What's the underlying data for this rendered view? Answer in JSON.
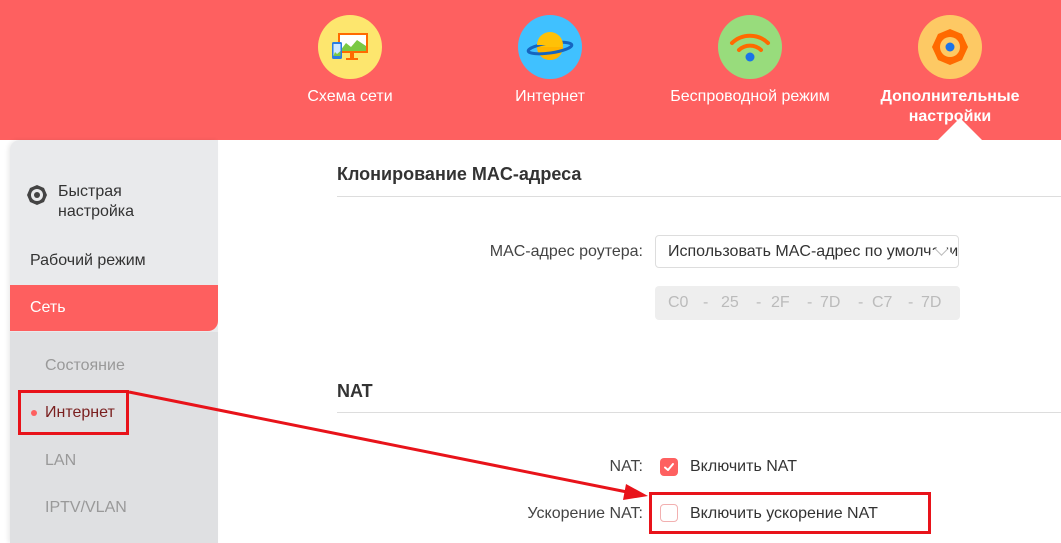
{
  "header": {
    "nav": [
      {
        "label": "Схема сети",
        "icon": "network-map-icon"
      },
      {
        "label": "Интернет",
        "icon": "planet-icon"
      },
      {
        "label": "Беспроводной режим",
        "icon": "wifi-icon"
      },
      {
        "label": "Дополнительные настройки",
        "icon": "gear-icon",
        "active": true
      }
    ]
  },
  "sidebar": {
    "items": [
      {
        "label": "Быстрая настройка",
        "icon": "gear-icon"
      },
      {
        "label": "Рабочий режим"
      },
      {
        "label": "Сеть",
        "active": true
      }
    ],
    "sub_items": [
      {
        "label": "Состояние"
      },
      {
        "label": "Интернет",
        "current": true
      },
      {
        "label": "LAN"
      },
      {
        "label": "IPTV/VLAN"
      }
    ]
  },
  "mac_clone": {
    "title": "Клонирование MAC-адреса",
    "router_mac_label": "MAC-адрес роутера:",
    "router_mac_select_value": "Использовать MAC-адрес по умолчанию",
    "mac_octets": [
      "C0",
      "25",
      "2F",
      "7D",
      "C7",
      "7D"
    ],
    "separator": "-"
  },
  "nat": {
    "title": "NAT",
    "nat_label": "NAT:",
    "nat_checkbox_label": "Включить NAT",
    "nat_checked": true,
    "accel_label": "Ускорение NAT:",
    "accel_checkbox_label": "Включить ускорение NAT",
    "accel_checked": false
  },
  "colors": {
    "brand": "#fe6060",
    "annotation": "#e8131a"
  }
}
